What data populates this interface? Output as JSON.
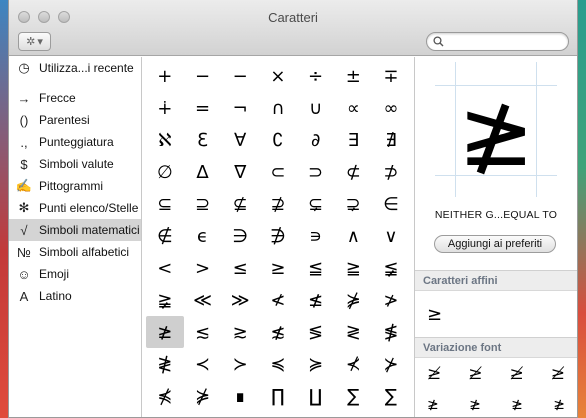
{
  "window": {
    "title": "Caratteri",
    "search": {
      "placeholder": "",
      "value": ""
    }
  },
  "sidebar": {
    "items": [
      {
        "icon": "clock-icon",
        "glyph": "◷",
        "label": "Utilizza...i recente"
      },
      {
        "icon": "arrow-icon",
        "glyph": "→",
        "label": "Frecce"
      },
      {
        "icon": "parentheses-icon",
        "glyph": "()",
        "label": "Parentesi"
      },
      {
        "icon": "punctuation-icon",
        "glyph": ".,",
        "label": "Punteggiatura"
      },
      {
        "icon": "dollar-icon",
        "glyph": "$",
        "label": "Simboli valute"
      },
      {
        "icon": "pictogram-icon",
        "glyph": "✍",
        "label": "Pittogrammi"
      },
      {
        "icon": "asterisk-icon",
        "glyph": "✻",
        "label": "Punti elenco/Stelle"
      },
      {
        "icon": "sqrt-icon",
        "glyph": "√",
        "label": "Simboli matematici"
      },
      {
        "icon": "numero-icon",
        "glyph": "№",
        "label": "Simboli alfabetici"
      },
      {
        "icon": "smiley-icon",
        "glyph": "☺",
        "label": "Emoji"
      },
      {
        "icon": "latin-a-icon",
        "glyph": "A",
        "label": "Latino"
      }
    ],
    "selected_index": 7
  },
  "grid": {
    "chars": [
      "+",
      "−",
      "−",
      "×",
      "÷",
      "±",
      "∓",
      "∔",
      "=",
      "¬",
      "∩",
      "∪",
      "∝",
      "∞",
      "ℵ",
      "ℇ",
      "∀",
      "∁",
      "∂",
      "∃",
      "∄",
      "∅",
      "∆",
      "∇",
      "⊂",
      "⊃",
      "⊄",
      "⊅",
      "⊆",
      "⊇",
      "⊈",
      "⊉",
      "⊊",
      "⊋",
      "∈",
      "∉",
      "ϵ",
      "∋",
      "∌",
      "∍",
      "∧",
      "∨",
      "<",
      ">",
      "≤",
      "≥",
      "≦",
      "≧",
      "≨",
      "≩",
      "≪",
      "≫",
      "≮",
      "≰",
      "⋡",
      "≯",
      "≱",
      "≲",
      "≳",
      "≴",
      "≶",
      "≷",
      "≸",
      "≹",
      "≺",
      "≻",
      "≼",
      "≽",
      "⊀",
      "⊁",
      "⋠",
      "⋡",
      "∎",
      "∏",
      "∐",
      "∑",
      "∑"
    ],
    "selected_index": 56
  },
  "detail": {
    "char": "≱",
    "name": "NEITHER G...EQUAL TO",
    "fav_button": "Aggiungi ai preferiti",
    "related_title": "Caratteri affini",
    "related_chars": [
      "≥"
    ],
    "variation_title": "Variazione font",
    "variation_chars": [
      "≱",
      "≱",
      "≱",
      "≱"
    ],
    "variation_chars_row2": [
      "≱",
      "≱",
      "≱",
      "≱"
    ]
  }
}
